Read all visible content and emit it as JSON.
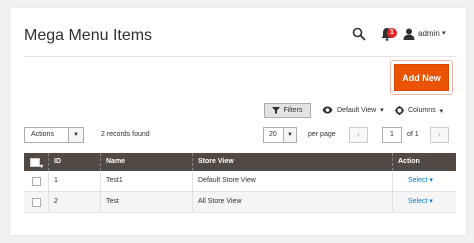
{
  "header": {
    "title": "Mega Menu Items",
    "notifications_count": "1",
    "user_name": "admin"
  },
  "toolbar": {
    "add_button_label": "Add New",
    "filters_label": "Filters",
    "view_label": "Default View",
    "columns_label": "Columns"
  },
  "grid_controls": {
    "actions_label": "Actions",
    "records_found": "2 records found",
    "per_page_value": "20",
    "per_page_label": "per page",
    "current_page": "1",
    "page_of": "of 1"
  },
  "grid": {
    "columns": [
      "ID",
      "Name",
      "Store View",
      "Action"
    ],
    "rows": [
      {
        "id": "1",
        "name": "Test1",
        "store_view": "Default Store View",
        "action": "Select"
      },
      {
        "id": "2",
        "name": "Test",
        "store_view": "All Store View",
        "action": "Select"
      }
    ]
  },
  "colors": {
    "accent": "#eb5202",
    "grid_header": "#514943",
    "link": "#007bdb",
    "badge": "#e22626"
  },
  "icons": [
    "search-icon",
    "bell-icon",
    "user-icon",
    "filter-icon",
    "eye-icon",
    "gear-icon"
  ]
}
